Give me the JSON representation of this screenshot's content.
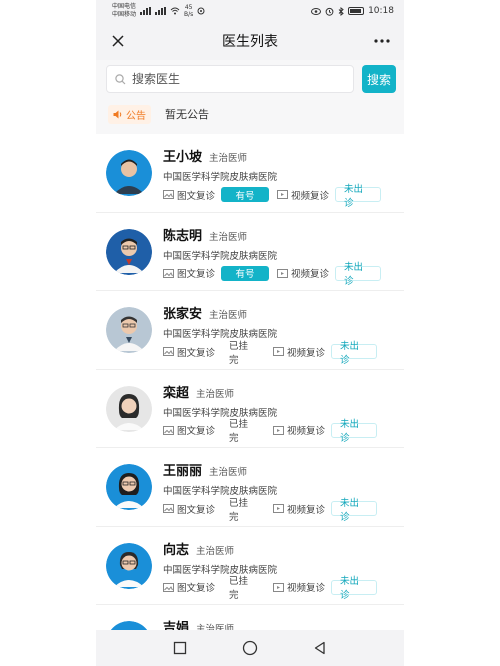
{
  "status_bar": {
    "carrier1": "中国电信",
    "carrier2": "中国移动",
    "net_speed_value": "45",
    "net_speed_unit": "B/s",
    "time": "10:18"
  },
  "nav": {
    "title": "医生列表"
  },
  "search": {
    "placeholder": "搜索医生",
    "button_label": "搜索"
  },
  "notice": {
    "tag_label": "公告",
    "text": "暂无公告"
  },
  "colors": {
    "accent": "#13b3c8",
    "notice": "#f07a22"
  },
  "doctors": [
    {
      "name": "王小坡",
      "title": "主治医师",
      "hospital": "中国医学科学院皮肤病医院",
      "text_consult": "图文复诊",
      "text_status": "有号",
      "video_consult": "视频复诊",
      "video_status": "未出诊"
    },
    {
      "name": "陈志明",
      "title": "主治医师",
      "hospital": "中国医学科学院皮肤病医院",
      "text_consult": "图文复诊",
      "text_status": "有号",
      "video_consult": "视频复诊",
      "video_status": "未出诊"
    },
    {
      "name": "张家安",
      "title": "主治医师",
      "hospital": "中国医学科学院皮肤病医院",
      "text_consult": "图文复诊",
      "text_status": "已挂完",
      "video_consult": "视频复诊",
      "video_status": "未出诊"
    },
    {
      "name": "栾超",
      "title": "主治医师",
      "hospital": "中国医学科学院皮肤病医院",
      "text_consult": "图文复诊",
      "text_status": "已挂完",
      "video_consult": "视频复诊",
      "video_status": "未出诊"
    },
    {
      "name": "王丽丽",
      "title": "主治医师",
      "hospital": "中国医学科学院皮肤病医院",
      "text_consult": "图文复诊",
      "text_status": "已挂完",
      "video_consult": "视频复诊",
      "video_status": "未出诊"
    },
    {
      "name": "向志",
      "title": "主治医师",
      "hospital": "中国医学科学院皮肤病医院",
      "text_consult": "图文复诊",
      "text_status": "已挂完",
      "video_consult": "视频复诊",
      "video_status": "未出诊"
    },
    {
      "name": "吉娟",
      "title": "主治医师",
      "hospital": "",
      "text_consult": "",
      "text_status": "",
      "video_consult": "",
      "video_status": ""
    }
  ]
}
